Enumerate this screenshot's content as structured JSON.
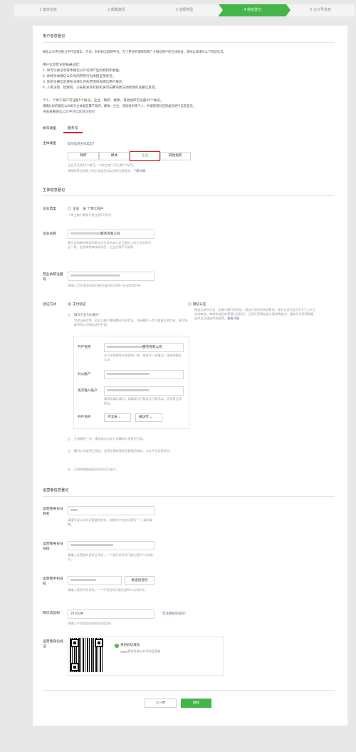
{
  "steps": [
    "1 基本信息",
    "2 邮箱激活",
    "3 选择类型",
    "4 信息登记",
    "5 公众号信息"
  ],
  "active_step": 3,
  "section_user_info": {
    "title": "用户信息登记",
    "intro": "微信公众平台致力于打造真实、合法、有效的互联网平台。为了更好的保障你和广大微信用户的合法权益，请你认真填写以下登记信息。",
    "after_review_title": "用户信息登记审核通过后：",
    "items": [
      "1. 你可以依法享有本微信公众号所产生的权利和收益；",
      "2. 你将对本微信公众号的所有行为承担全部责任；",
      "3. 你的注册信息将在法律允许的范围内向微信用户展示；",
      "4. 人民法院、检察院、公安机关等有权机关可向腾讯依法调取你的注册信息等。"
    ],
    "limit_text": "个人、个体工商户可注册5个帐号，企业、政府、媒体、其他组织可注册50个帐号。",
    "confirm_text": "请确认你的微信公众帐号主体类型属于政府、媒体、企业、其他组织或个人，并请按照对应的类别进行信息登记。",
    "guide_prefix": "点击查看",
    "guide_link": "微信公众平台信息登记指引"
  },
  "account_type": {
    "label": "帐号类型",
    "value": "服务号"
  },
  "subject_type": {
    "label": "主体类型",
    "help_link": "如何选择主体类型？",
    "options": [
      "政府",
      "媒体",
      "企业",
      "其他组织"
    ],
    "selected": "企业",
    "hint1": "企业可注册50个帐号，个体工商户可注册5个帐号。",
    "hint2_prefix": "请按照营业执照上的主体类型如实选择注册类型，",
    "hint2_link": "了解详情"
  },
  "section_subject": {
    "title": "主体信息登记"
  },
  "company_type": {
    "label": "企业类型",
    "options": [
      "企业",
      "个体工商户"
    ],
    "selected": "个体工商户",
    "hint": "个体工商户最多只能注册5个帐号"
  },
  "company_name": {
    "label": "企业名称",
    "value_suffix": "服务有限公司",
    "hint": "需与当地政府颁发的商业许可证书或企业注册证上的企业名称完全一致，信息审核审核成功后，企业名称不可修改"
  },
  "license_no": {
    "label": "营业执照注册号",
    "hint": "请输入15位营业执照注册号或18位的统一社会信用代码"
  },
  "verify_method": {
    "label": "验证方式",
    "pay_option": "支付验证",
    "wechat_option": "微信认证",
    "wechat_desc": "微信注册并认证，无需小额打款验证，需支付300元审核费用。提交认证后会在1-5个工作日完成审核。审核完成后你获得认证标识，订阅号获得自定义菜单等能力；服务号可获得高级接口及开通支付权限等。",
    "wechat_link": "查看详情",
    "step1_title": "填写企业对公账户：",
    "step1_desc": "为验证真实性，此对公账户需给腾讯打款验证。注册最后一步可查看打款信息，请尽快联系贵公司财务进行打款。",
    "step2": "注册最后一步，需用该对公账户向腾讯公司进行打款；",
    "step3": "腾讯公司收到汇款后，会将注册结果发至管理员微信，公众平台也将同步；",
    "step4": "打款将原路退回至你的对公账户。"
  },
  "bank_form": {
    "account_name_label": "开户名称",
    "account_name_suffix": "服务有限公司",
    "account_name_hint": "开户名称需和主体保持一致，若有不一致情况，请选择微信认证",
    "account_no_label": "对公账户",
    "reenter_label": "再次输入账户",
    "reenter_hint": "请再次确认填写，请确保与打款验证打款无误，否则将注册终止。",
    "bank_place_label": "开户地点",
    "province": "河北省",
    "city": "廊坊市"
  },
  "section_operator": {
    "title": "运营者信息登记"
  },
  "operator": {
    "name_label": "运营者身份证姓名",
    "name_hint": "请填写该公众号运营者的姓名，如果名字包含分隔号“·”，请勿省略。",
    "id_label": "运营者身份证号码",
    "id_hint": "请输入运营者的身份证号码，一个身份证号码只能注册5个公众帐号。",
    "phone_label": "运营者手机号码",
    "phone_hint": "请输入您的手机号码，一个手机号码只能注册5个公众帐号。",
    "send_code": "发送验证码",
    "sms_label": "短信验证码",
    "sms_value": "213339",
    "sms_help": "无法接收验证码？",
    "sms_hint": "请输入手机短信收到的6位验证码",
    "idverify_label": "运营者身份验证",
    "verify_success": "身份验证成功",
    "verify_note": "将作为该公众号的运营者"
  },
  "buttons": {
    "prev": "上一步",
    "next": "继续"
  },
  "colors": {
    "accent": "#44b549",
    "link": "#576b95",
    "highlight": "#e02020"
  }
}
